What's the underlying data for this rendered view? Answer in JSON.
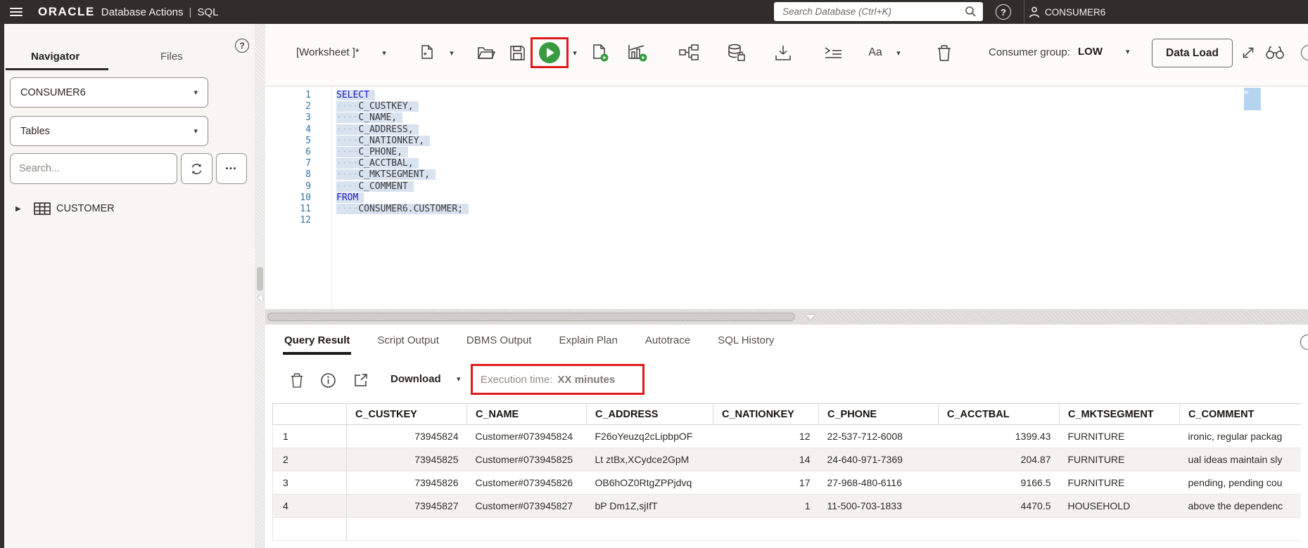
{
  "header": {
    "brand": "ORACLE",
    "product": "Database Actions",
    "separator": "|",
    "app": "SQL",
    "search_placeholder": "Search Database (Ctrl+K)",
    "user": "CONSUMER6",
    "help_glyph": "?"
  },
  "sidebar": {
    "tabs": [
      {
        "label": "Navigator",
        "active": true
      },
      {
        "label": "Files",
        "active": false
      }
    ],
    "help_glyph": "?",
    "schema_select": "CONSUMER6",
    "object_type_select": "Tables",
    "search_placeholder": "Search...",
    "tree": [
      {
        "label": "CUSTOMER"
      }
    ]
  },
  "toolbar": {
    "worksheet_label": "[Worksheet ]*",
    "font_size_label": "Aa",
    "consumer_group_label": "Consumer group:",
    "consumer_group_value": "LOW",
    "data_load_label": "Data Load"
  },
  "icons": {
    "caret_down": "▾",
    "tree_collapsed": "▶",
    "ellipsis": "•••",
    "info_glyph": "i"
  },
  "editor": {
    "lines": [
      {
        "n": 1,
        "indent": false,
        "kw": true,
        "selected": true,
        "text": "SELECT"
      },
      {
        "n": 2,
        "indent": true,
        "kw": false,
        "selected": true,
        "text": "C_CUSTKEY,"
      },
      {
        "n": 3,
        "indent": true,
        "kw": false,
        "selected": true,
        "text": "C_NAME,"
      },
      {
        "n": 4,
        "indent": true,
        "kw": false,
        "selected": true,
        "text": "C_ADDRESS,"
      },
      {
        "n": 5,
        "indent": true,
        "kw": false,
        "selected": true,
        "text": "C_NATIONKEY,"
      },
      {
        "n": 6,
        "indent": true,
        "kw": false,
        "selected": true,
        "text": "C_PHONE,"
      },
      {
        "n": 7,
        "indent": true,
        "kw": false,
        "selected": true,
        "text": "C_ACCTBAL,"
      },
      {
        "n": 8,
        "indent": true,
        "kw": false,
        "selected": true,
        "text": "C_MKTSEGMENT,"
      },
      {
        "n": 9,
        "indent": true,
        "kw": false,
        "selected": true,
        "text": "C_COMMENT"
      },
      {
        "n": 10,
        "indent": false,
        "kw": true,
        "selected": true,
        "text": "FROM"
      },
      {
        "n": 11,
        "indent": true,
        "kw": false,
        "selected": true,
        "text": "CONSUMER6.CUSTOMER;"
      },
      {
        "n": 12,
        "indent": false,
        "kw": false,
        "selected": false,
        "text": ""
      }
    ]
  },
  "results": {
    "tabs": [
      "Query Result",
      "Script Output",
      "DBMS Output",
      "Explain Plan",
      "Autotrace",
      "SQL History"
    ],
    "active_tab": "Query Result",
    "download_label": "Download",
    "execution_time_label": "Execution time:",
    "execution_time_value": "XX minutes",
    "table": {
      "columns": [
        "C_CUSTKEY",
        "C_NAME",
        "C_ADDRESS",
        "C_NATIONKEY",
        "C_PHONE",
        "C_ACCTBAL",
        "C_MKTSEGMENT",
        "C_COMMENT"
      ],
      "rows": [
        {
          "num": "1",
          "cells": [
            "73945824",
            "Customer#073945824",
            "F26oYeuzq2cLipbpOF",
            "12",
            "22-537-712-6008",
            "1399.43",
            "FURNITURE",
            "ironic, regular packag"
          ]
        },
        {
          "num": "2",
          "cells": [
            "73945825",
            "Customer#073945825",
            "Lt ztBx,XCydce2GpM",
            "14",
            "24-640-971-7369",
            "204.87",
            "FURNITURE",
            "ual ideas maintain sly"
          ]
        },
        {
          "num": "3",
          "cells": [
            "73945826",
            "Customer#073945826",
            "OB6hOZ0RtgZPPjdvq",
            "17",
            "27-968-480-6116",
            "9166.5",
            "FURNITURE",
            "pending, pending cou"
          ]
        },
        {
          "num": "4",
          "cells": [
            "73945827",
            "Customer#073945827",
            "bP Dm1Z,sjIfT",
            "1",
            "11-500-703-1833",
            "4470.5",
            "HOUSEHOLD",
            "above the dependenc"
          ]
        },
        {
          "num": "",
          "cells": [
            "",
            "",
            "",
            "",
            "",
            "",
            "",
            ""
          ]
        }
      ]
    }
  },
  "colors": {
    "header_bg": "#312d2a",
    "annotation_red": "#e01b1b",
    "run_green": "#379b41",
    "keyword_blue": "#1b17cb",
    "line_number_blue": "#2f76a4",
    "selection_blue": "#d9e3f0"
  }
}
